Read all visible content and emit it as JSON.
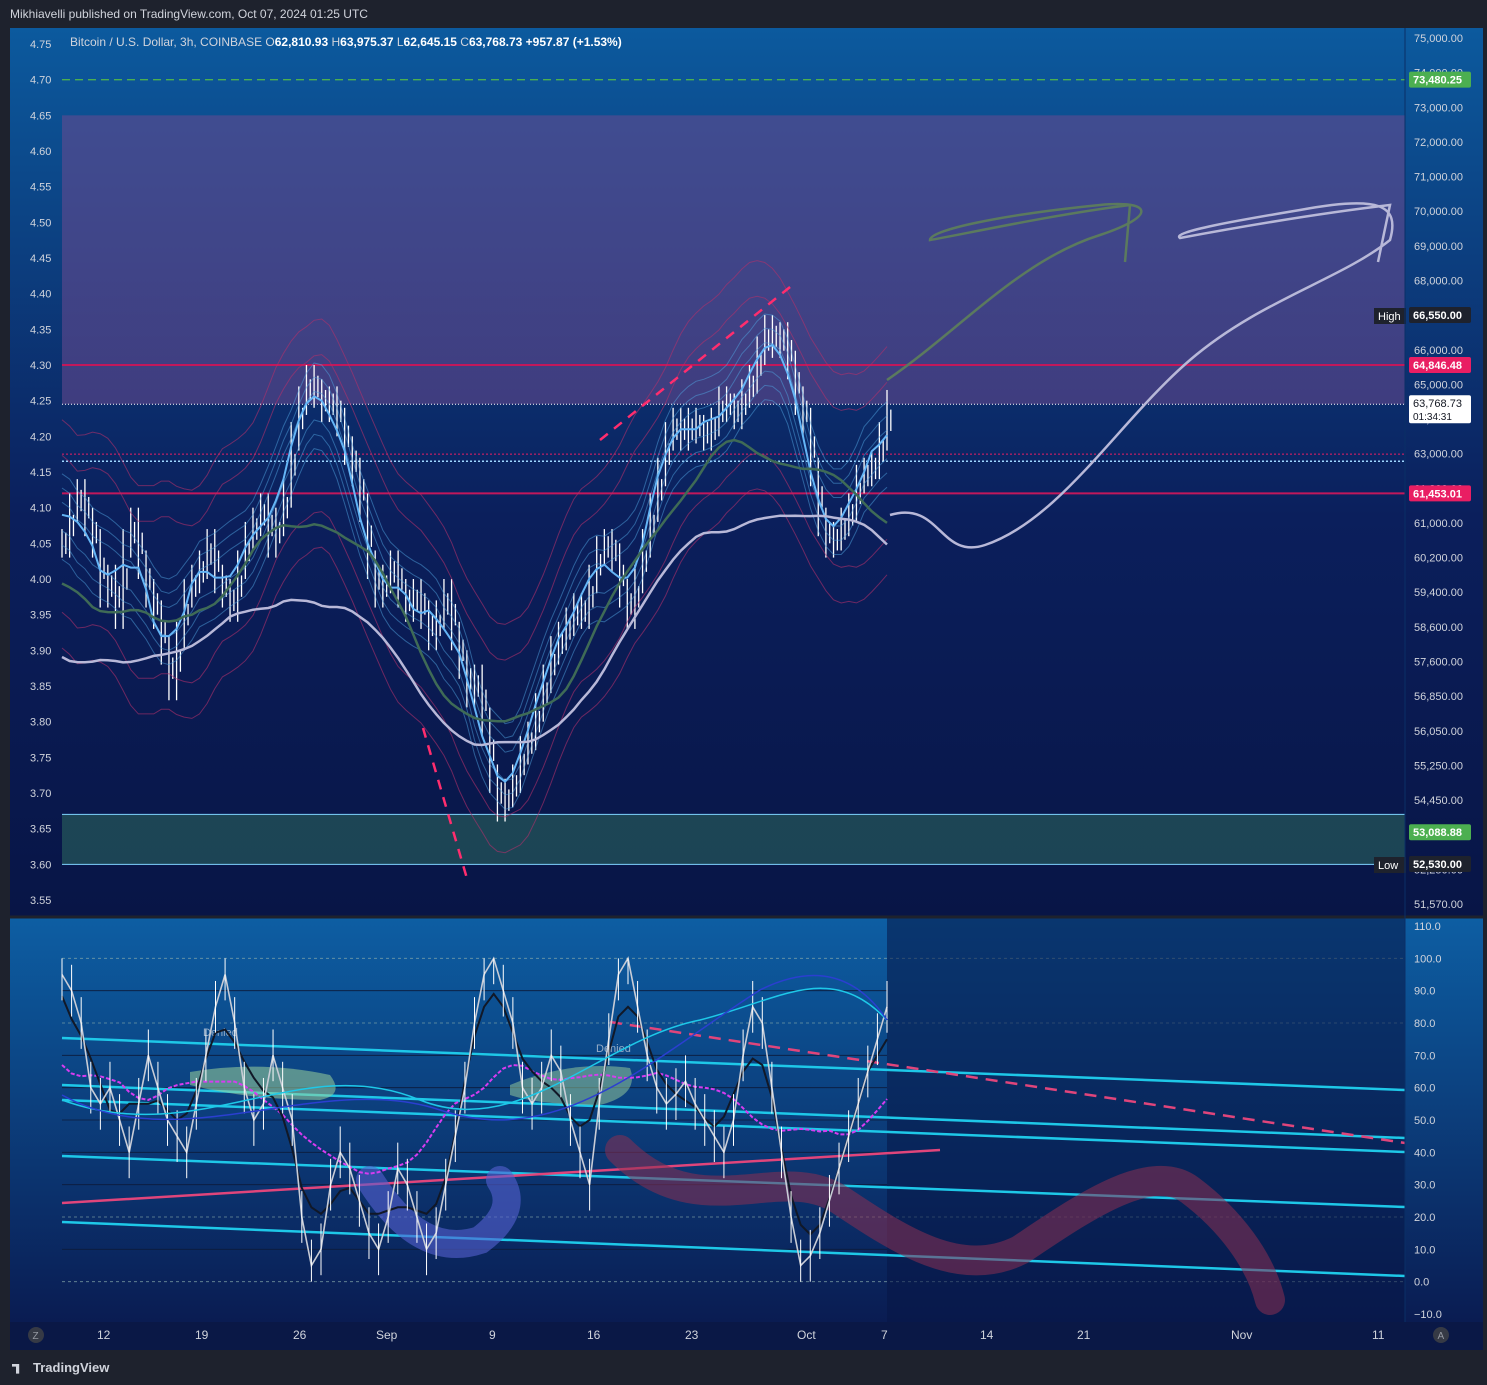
{
  "header": {
    "published_line": "Mikhiavelli published on TradingView.com, Oct 07, 2024 01:25 UTC"
  },
  "legend": {
    "symbol": "Bitcoin / U.S. Dollar, 3h, COINBASE",
    "o_label": "O",
    "o_value": "62,810.93",
    "h_label": "H",
    "h_value": "63,975.37",
    "l_label": "L",
    "l_value": "62,645.15",
    "c_label": "C",
    "c_value": "63,768.73",
    "change": "+957.87 (+1.53%)"
  },
  "chart_data": [
    {
      "type": "line",
      "panel": "price",
      "left_axis_ticks": [
        "4.75",
        "4.70",
        "4.65",
        "4.60",
        "4.55",
        "4.50",
        "4.45",
        "4.40",
        "4.35",
        "4.30",
        "4.25",
        "4.20",
        "4.15",
        "4.10",
        "4.05",
        "4.00",
        "3.95",
        "3.90",
        "3.85",
        "3.80",
        "3.75",
        "3.70",
        "3.65",
        "3.60",
        "3.55"
      ],
      "left_axis_range": [
        3.55,
        4.75
      ],
      "right_axis_ticks": [
        "75,000.00",
        "74,000.00",
        "73,000.00",
        "72,000.00",
        "71,000.00",
        "70,000.00",
        "69,000.00",
        "68,000.00",
        "67,000.00",
        "66,000.00",
        "65,000.00",
        "64,000.00",
        "63,000.00",
        "61,800.00",
        "61,000.00",
        "60,200.00",
        "59,400.00",
        "58,600.00",
        "57,600.00",
        "56,850.00",
        "56,050.00",
        "55,250.00",
        "54,450.00",
        "53,650.00",
        "52,250.00",
        "51,570.00"
      ],
      "price_labels": [
        {
          "text": "73,480.25",
          "color": "#4caf50",
          "style": "dashed-line",
          "value": 73480.25
        },
        {
          "text": "High",
          "value2": "66,550.00",
          "color": "#1e222d"
        },
        {
          "text": "64,846.48",
          "color": "#e91e63",
          "value": 64846.48
        },
        {
          "text": "63,768.73",
          "sub": "01:34:31",
          "color": "#ffffff",
          "value": 63768.73
        },
        {
          "text": "61,453.01",
          "color": "#e91e63",
          "value": 61453.01
        },
        {
          "text": "53,088.88",
          "color": "#4caf50",
          "value": 53088.88
        },
        {
          "text": "Low",
          "value2": "52,530.00",
          "color": "#1e222d"
        }
      ],
      "zones": [
        {
          "name": "upper-zone",
          "from_log": 4.245,
          "to_log": 4.65,
          "color": "#6b4a8f"
        },
        {
          "name": "support-zone",
          "from_log": 3.6,
          "to_log": 3.67,
          "color": "#2e6b5e"
        }
      ],
      "price_series_log": [
        4.05,
        4.1,
        4.12,
        4.08,
        4.05,
        3.98,
        4.0,
        3.95,
        4.05,
        4.08,
        4.02,
        3.98,
        3.95,
        3.9,
        3.85,
        3.92,
        3.98,
        4.0,
        4.02,
        4.05,
        4.0,
        3.98,
        3.96,
        4.02,
        4.06,
        4.08,
        4.1,
        4.05,
        4.08,
        4.12,
        4.2,
        4.25,
        4.28,
        4.26,
        4.24,
        4.25,
        4.22,
        4.18,
        4.15,
        4.1,
        4.02,
        3.98,
        4.0,
        4.02,
        3.98,
        3.96,
        3.98,
        3.95,
        3.92,
        3.95,
        3.98,
        3.92,
        3.88,
        3.84,
        3.86,
        3.8,
        3.72,
        3.68,
        3.7,
        3.72,
        3.76,
        3.78,
        3.82,
        3.86,
        3.9,
        3.92,
        3.94,
        3.96,
        3.95,
        4.0,
        4.04,
        4.05,
        4.03,
        3.98,
        3.95,
        4.0,
        4.05,
        4.1,
        4.15,
        4.2,
        4.22,
        4.2,
        4.22,
        4.21,
        4.2,
        4.22,
        4.25,
        4.24,
        4.23,
        4.26,
        4.28,
        4.32,
        4.35,
        4.33,
        4.34,
        4.3,
        4.25,
        4.22,
        4.15,
        4.08,
        4.05,
        4.06,
        4.08,
        4.1,
        4.14,
        4.15,
        4.16,
        4.2,
        4.245
      ]
    },
    {
      "type": "line",
      "panel": "oscillator",
      "right_axis_ticks": [
        "110.0",
        "100.0",
        "90.0",
        "80.0",
        "70.0",
        "60.0",
        "50.0",
        "40.0",
        "30.0",
        "20.0",
        "10.0",
        "0.0",
        "−10.0"
      ],
      "range": [
        -10,
        110
      ],
      "series": [
        {
          "values": [
            95,
            90,
            80,
            60,
            55,
            60,
            50,
            40,
            55,
            70,
            60,
            50,
            45,
            40,
            55,
            70,
            85,
            95,
            80,
            60,
            50,
            55,
            70,
            60,
            50,
            20,
            5,
            10,
            30,
            40,
            35,
            25,
            15,
            10,
            20,
            35,
            30,
            20,
            10,
            15,
            30,
            45,
            60,
            80,
            95,
            100,
            90,
            80,
            60,
            55,
            60,
            70,
            65,
            50,
            40,
            30,
            55,
            75,
            95,
            100,
            85,
            70,
            60,
            55,
            58,
            62,
            55,
            50,
            45,
            40,
            50,
            70,
            85,
            80,
            60,
            40,
            20,
            5,
            8,
            15,
            25,
            35,
            45,
            55,
            65,
            75,
            85
          ]
        }
      ],
      "labels": [
        "Denied",
        "Denied"
      ]
    }
  ],
  "time_axis": [
    "12",
    "19",
    "26",
    "Sep",
    "9",
    "16",
    "23",
    "Oct",
    "7",
    "14",
    "21",
    "Nov",
    "11"
  ],
  "controls": {
    "zoom_btn": "Z",
    "auto_btn": "A"
  },
  "footer": {
    "brand": "TradingView"
  }
}
